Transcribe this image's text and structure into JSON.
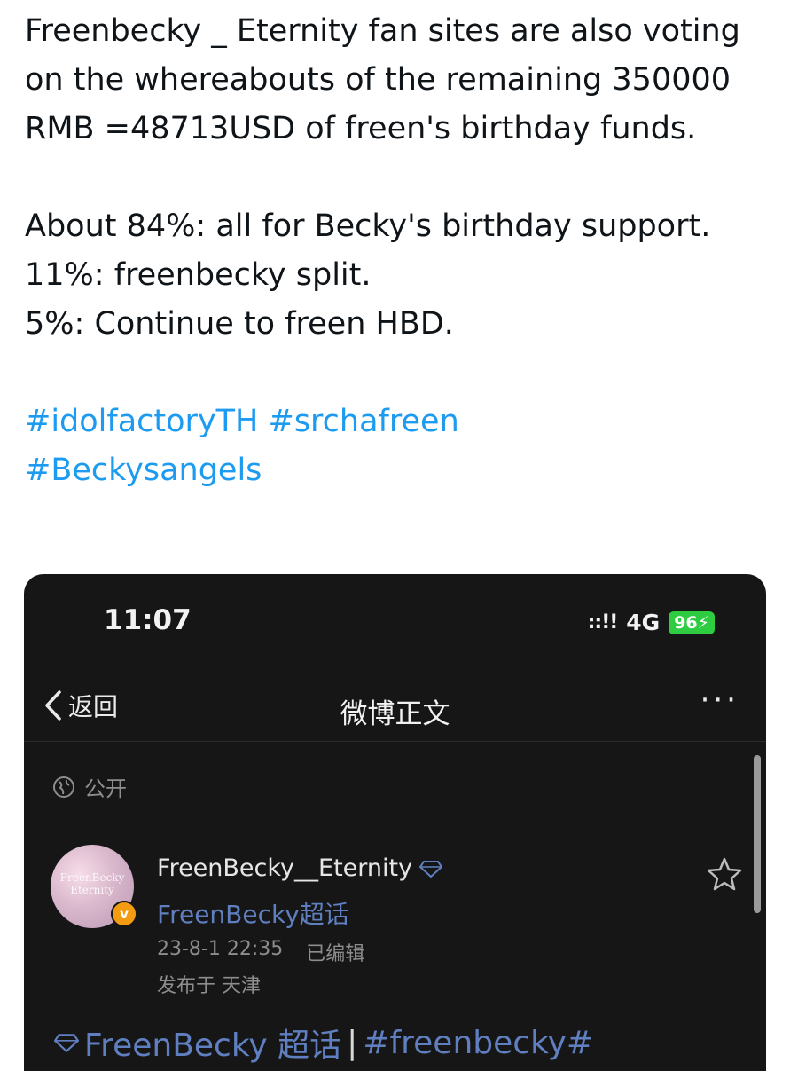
{
  "tweet": {
    "paragraph1": "Freenbecky _ Eternity fan sites are also voting on the whereabouts of the remaining 350000 RMB =48713USD of freen's birthday funds.",
    "line_84": "About 84%: all for Becky's birthday support.",
    "line_11": "11%: freenbecky split.",
    "line_5": "5%: Continue to freen HBD.",
    "hashtags": [
      "#idolfactoryTH",
      "#srchafreen",
      "#Beckysangels"
    ],
    "colors": {
      "text": "#0f1419",
      "hashtag": "#1d9bf0"
    }
  },
  "phone": {
    "status_bar": {
      "time": "11:07",
      "signal_icon": "signal-bars-icon",
      "network": "4G",
      "battery": "96"
    },
    "nav": {
      "back_label": "返回",
      "title": "微博正文",
      "more_icon": "more-dots-icon"
    },
    "visibility": {
      "icon": "globe-icon",
      "label": "公开"
    },
    "post": {
      "avatar_text": "FreenBecky Eternity",
      "username": "FreenBecky__Eternity",
      "supertopic": "FreenBecky超话",
      "timestamp": "23-8-1 22:35",
      "edited": "已编辑",
      "location": "发布于 天津",
      "body_topic": "FreenBecky 超话",
      "body_separator": "|",
      "body_hashtag": "#freenbecky#",
      "colors": {
        "link": "#5f7fc0",
        "badge": "#f39c12",
        "battery": "#2ecc40"
      }
    }
  }
}
